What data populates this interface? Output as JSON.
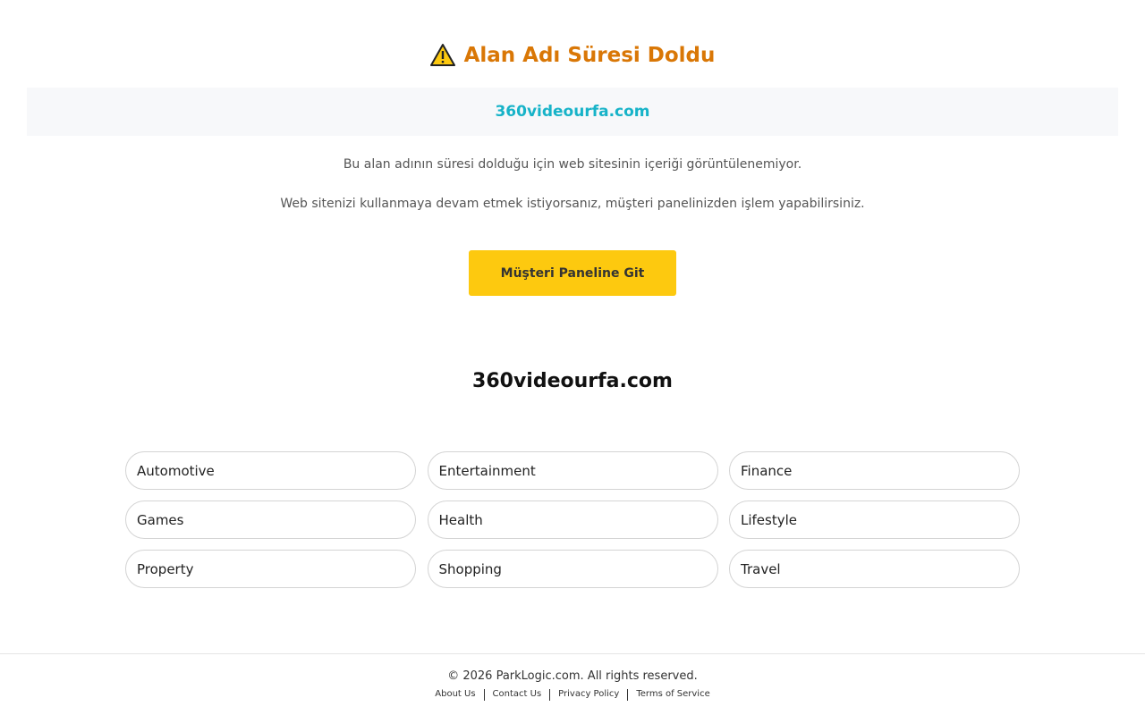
{
  "header": {
    "title": "Alan Adı Süresi Doldu",
    "icon": "warning-icon"
  },
  "domain": {
    "name": "360videourfa.com",
    "color": "#17b3c8"
  },
  "messages": {
    "line1": "Bu alan adının süresi dolduğu için web sitesinin içeriği görüntülenemiyor.",
    "line2": "Web sitenizi kullanmaya devam etmek istiyorsanız, müşteri panelinizden işlem yapabilirsiniz."
  },
  "cta": {
    "label": "Müşteri Paneline Git",
    "color": "#fdc90f"
  },
  "site_heading": "360videourfa.com",
  "categories": [
    "Automotive",
    "Entertainment",
    "Finance",
    "Games",
    "Health",
    "Lifestyle",
    "Property",
    "Shopping",
    "Travel"
  ],
  "footer": {
    "copyright": "© 2026 ParkLogic.com. All rights reserved.",
    "links": [
      "About Us",
      "Contact Us",
      "Privacy Policy",
      "Terms of Service"
    ]
  },
  "colors": {
    "title": "#d97706"
  }
}
